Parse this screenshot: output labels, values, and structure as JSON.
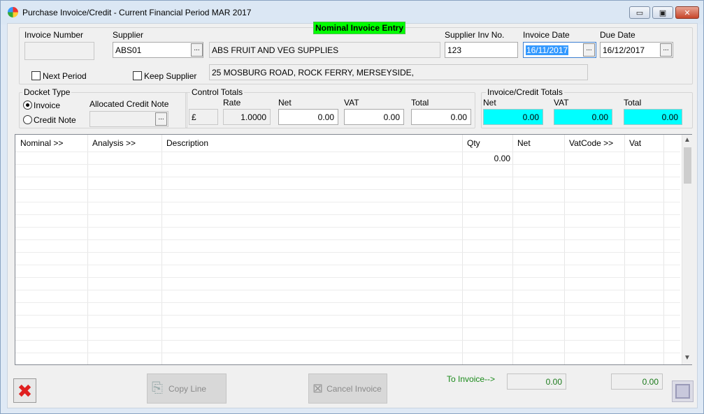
{
  "window": {
    "title": "Purchase Invoice/Credit - Current Financial Period MAR 2017",
    "controls": {
      "minimize": "▭",
      "maximize": "▣",
      "close": "✕"
    }
  },
  "badge": "Nominal Invoice Entry",
  "header": {
    "invoice_number": {
      "label": "Invoice Number",
      "value": ""
    },
    "supplier": {
      "label": "Supplier",
      "value": "ABS01",
      "name": "ABS  FRUIT AND VEG SUPPLIES",
      "address": "25 MOSBURG ROAD, ROCK FERRY, MERSEYSIDE,"
    },
    "supplier_inv_no": {
      "label": "Supplier Inv No.",
      "value": "123"
    },
    "invoice_date": {
      "label": "Invoice Date",
      "value": "16/11/2017"
    },
    "due_date": {
      "label": "Due Date",
      "value": "16/12/2017"
    },
    "next_period": {
      "label": "Next Period",
      "checked": false
    },
    "keep_supplier": {
      "label": "Keep Supplier",
      "checked": false
    },
    "ellipsis": "..."
  },
  "docket": {
    "title": "Docket Type",
    "invoice_label": "Invoice",
    "credit_label": "Credit Note",
    "selected": "Invoice",
    "allocated_label": "Allocated Credit Note",
    "allocated_value": ""
  },
  "control_totals": {
    "title": "Control Totals",
    "currency": "£",
    "rate_label": "Rate",
    "rate": "1.0000",
    "net_label": "Net",
    "net": "0.00",
    "vat_label": "VAT",
    "vat": "0.00",
    "total_label": "Total",
    "total": "0.00"
  },
  "invoice_totals": {
    "title": "Invoice/Credit Totals",
    "net_label": "Net",
    "net": "0.00",
    "vat_label": "VAT",
    "vat": "0.00",
    "total_label": "Total",
    "total": "0.00",
    "highlight_color": "#00ffff"
  },
  "grid": {
    "columns": [
      "Nominal >>",
      "Analysis >>",
      "Description",
      "Qty",
      "Net",
      "VatCode >>",
      "Vat"
    ],
    "rows": [
      {
        "nominal": "",
        "analysis": "",
        "description": "",
        "qty": "0.00",
        "net": "",
        "vatcode": "",
        "vat": ""
      }
    ]
  },
  "footer": {
    "copy_line": "Copy Line",
    "cancel_invoice": "Cancel Invoice",
    "to_invoice_label": "To Invoice-->",
    "to_invoice_value": "0.00",
    "remaining_value": "0.00"
  }
}
